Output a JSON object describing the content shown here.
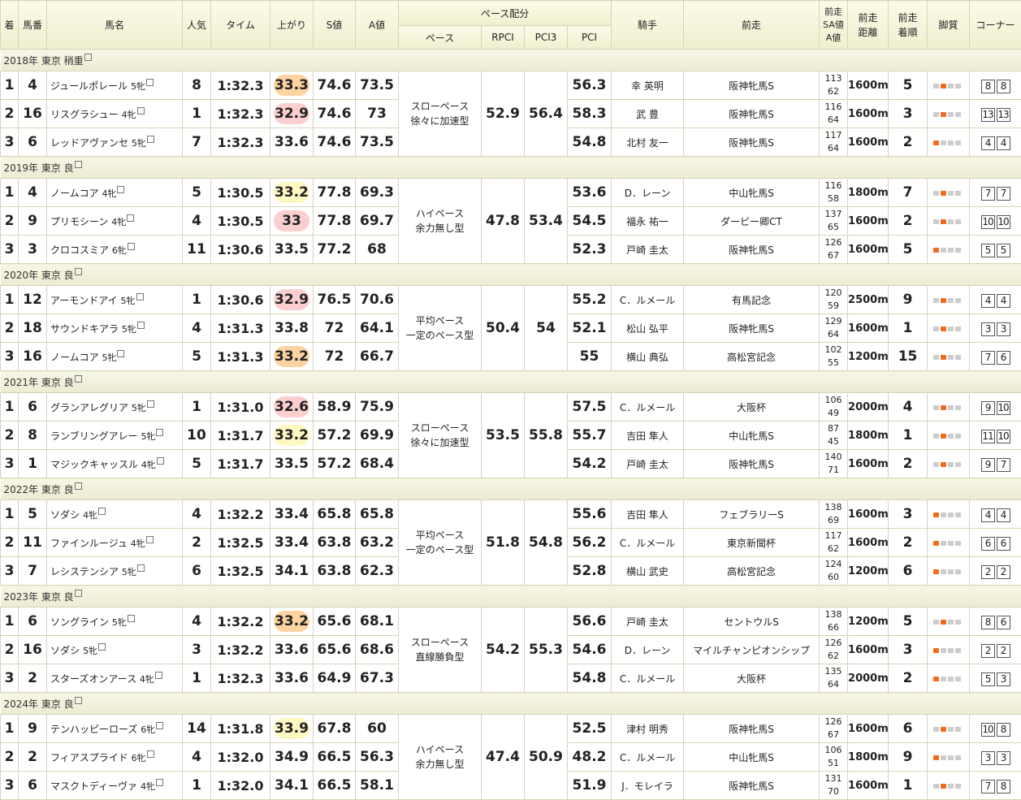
{
  "headers": {
    "chaku": "着",
    "umaban": "馬番",
    "bamei": "馬名",
    "ninki": "人気",
    "time": "タイム",
    "agari": "上がり",
    "s": "S値",
    "a": "A値",
    "pace_group": "ペース配分",
    "pace": "ペース",
    "rpci": "RPCI",
    "pci3": "PCI3",
    "pci": "PCI",
    "jockey": "騎手",
    "prev": "前走",
    "sa": [
      "前走",
      "SA値",
      "A値"
    ],
    "prevdist": [
      "前走",
      "距離"
    ],
    "prevrank": [
      "前走",
      "着順"
    ],
    "leg": "脚質",
    "corner": "コーナー"
  },
  "sections": [
    {
      "title": "2018年 東京 稍重",
      "pace": [
        "スローペース",
        "徐々に加速型"
      ],
      "rpci": "52.9",
      "pci3": "56.4",
      "rows": [
        {
          "rank": "1",
          "num": "4",
          "name": "ジュールポレール",
          "sex": "5牝",
          "ninki": "8",
          "time": "1:32.3",
          "agari": "33.3",
          "hl": "orange",
          "s": "74.6",
          "a": "73.5",
          "pci": "56.3",
          "jockey": "幸 英明",
          "prev": "阪神牝馬S",
          "sa1": "113",
          "sa2": "62",
          "dist": "1600m",
          "prank": "5",
          "leg": 2,
          "c1": "8",
          "c2": "8"
        },
        {
          "rank": "2",
          "num": "16",
          "name": "リスグラシュー",
          "sex": "4牝",
          "ninki": "1",
          "time": "1:32.3",
          "agari": "32.9",
          "hl": "pink",
          "s": "74.6",
          "a": "73",
          "pci": "58.3",
          "jockey": "武 豊",
          "prev": "阪神牝馬S",
          "sa1": "116",
          "sa2": "64",
          "dist": "1600m",
          "prank": "3",
          "leg": 2,
          "c1": "13",
          "c2": "13"
        },
        {
          "rank": "3",
          "num": "6",
          "name": "レッドアヴァンセ",
          "sex": "5牝",
          "ninki": "7",
          "time": "1:32.3",
          "agari": "33.6",
          "hl": "",
          "s": "74.6",
          "a": "73.5",
          "pci": "54.8",
          "jockey": "北村 友一",
          "prev": "阪神牝馬S",
          "sa1": "117",
          "sa2": "64",
          "dist": "1600m",
          "prank": "2",
          "leg": 1,
          "c1": "4",
          "c2": "4"
        }
      ]
    },
    {
      "title": "2019年 東京 良",
      "pace": [
        "ハイペース",
        "余力無し型"
      ],
      "rpci": "47.8",
      "pci3": "53.4",
      "rows": [
        {
          "rank": "1",
          "num": "4",
          "name": "ノームコア",
          "sex": "4牝",
          "ninki": "5",
          "time": "1:30.5",
          "agari": "33.2",
          "hl": "yellow",
          "s": "77.8",
          "a": "69.3",
          "pci": "53.6",
          "jockey": "D．レーン",
          "prev": "中山牝馬S",
          "sa1": "116",
          "sa2": "58",
          "dist": "1800m",
          "prank": "7",
          "leg": 2,
          "c1": "7",
          "c2": "7"
        },
        {
          "rank": "2",
          "num": "9",
          "name": "プリモシーン",
          "sex": "4牝",
          "ninki": "4",
          "time": "1:30.5",
          "agari": "33",
          "hl": "pink",
          "s": "77.8",
          "a": "69.7",
          "pci": "54.5",
          "jockey": "福永 祐一",
          "prev": "ダービー卿CT",
          "sa1": "137",
          "sa2": "65",
          "dist": "1600m",
          "prank": "2",
          "leg": 2,
          "c1": "10",
          "c2": "10"
        },
        {
          "rank": "3",
          "num": "3",
          "name": "クロコスミア",
          "sex": "6牝",
          "ninki": "11",
          "time": "1:30.6",
          "agari": "33.5",
          "hl": "",
          "s": "77.2",
          "a": "68",
          "pci": "52.3",
          "jockey": "戸崎 圭太",
          "prev": "阪神牝馬S",
          "sa1": "126",
          "sa2": "67",
          "dist": "1600m",
          "prank": "5",
          "leg": 1,
          "c1": "5",
          "c2": "5"
        }
      ]
    },
    {
      "title": "2020年 東京 良",
      "pace": [
        "平均ペース",
        "一定のペース型"
      ],
      "rpci": "50.4",
      "pci3": "54",
      "rows": [
        {
          "rank": "1",
          "num": "12",
          "name": "アーモンドアイ",
          "sex": "5牝",
          "ninki": "1",
          "time": "1:30.6",
          "agari": "32.9",
          "hl": "pink",
          "s": "76.5",
          "a": "70.6",
          "pci": "55.2",
          "jockey": "C．ルメール",
          "prev": "有馬記念",
          "sa1": "120",
          "sa2": "59",
          "dist": "2500m",
          "prank": "9",
          "leg": 2,
          "c1": "4",
          "c2": "4"
        },
        {
          "rank": "2",
          "num": "18",
          "name": "サウンドキアラ",
          "sex": "5牝",
          "ninki": "4",
          "time": "1:31.3",
          "agari": "33.8",
          "hl": "",
          "s": "72",
          "a": "64.1",
          "pci": "52.1",
          "jockey": "松山 弘平",
          "prev": "阪神牝馬S",
          "sa1": "129",
          "sa2": "64",
          "dist": "1600m",
          "prank": "1",
          "leg": 2,
          "c1": "3",
          "c2": "3"
        },
        {
          "rank": "3",
          "num": "16",
          "name": "ノームコア",
          "sex": "5牝",
          "ninki": "5",
          "time": "1:31.3",
          "agari": "33.2",
          "hl": "orange",
          "s": "72",
          "a": "66.7",
          "pci": "55",
          "jockey": "横山 典弘",
          "prev": "高松宮記念",
          "sa1": "102",
          "sa2": "55",
          "dist": "1200m",
          "prank": "15",
          "leg": 2,
          "c1": "7",
          "c2": "6"
        }
      ]
    },
    {
      "title": "2021年 東京 良",
      "pace": [
        "スローペース",
        "徐々に加速型"
      ],
      "rpci": "53.5",
      "pci3": "55.8",
      "rows": [
        {
          "rank": "1",
          "num": "6",
          "name": "グランアレグリア",
          "sex": "5牝",
          "ninki": "1",
          "time": "1:31.0",
          "agari": "32.6",
          "hl": "pink",
          "s": "58.9",
          "a": "75.9",
          "pci": "57.5",
          "jockey": "C．ルメール",
          "prev": "大阪杯",
          "sa1": "106",
          "sa2": "49",
          "dist": "2000m",
          "prank": "4",
          "leg": 2,
          "c1": "9",
          "c2": "10"
        },
        {
          "rank": "2",
          "num": "8",
          "name": "ランブリングアレー",
          "sex": "5牝",
          "ninki": "10",
          "time": "1:31.7",
          "agari": "33.2",
          "hl": "yellow",
          "s": "57.2",
          "a": "69.9",
          "pci": "55.7",
          "jockey": "吉田 隼人",
          "prev": "中山牝馬S",
          "sa1": "87",
          "sa2": "45",
          "dist": "1800m",
          "prank": "1",
          "leg": 2,
          "c1": "11",
          "c2": "10"
        },
        {
          "rank": "3",
          "num": "1",
          "name": "マジックキャッスル",
          "sex": "4牝",
          "ninki": "5",
          "time": "1:31.7",
          "agari": "33.5",
          "hl": "",
          "s": "57.2",
          "a": "68.4",
          "pci": "54.2",
          "jockey": "戸崎 圭太",
          "prev": "阪神牝馬S",
          "sa1": "140",
          "sa2": "71",
          "dist": "1600m",
          "prank": "2",
          "leg": 2,
          "c1": "9",
          "c2": "7"
        }
      ]
    },
    {
      "title": "2022年 東京 良",
      "pace": [
        "平均ペース",
        "一定のペース型"
      ],
      "rpci": "51.8",
      "pci3": "54.8",
      "rows": [
        {
          "rank": "1",
          "num": "5",
          "name": "ソダシ",
          "sex": "4牝",
          "ninki": "4",
          "time": "1:32.2",
          "agari": "33.4",
          "hl": "",
          "s": "65.8",
          "a": "65.8",
          "pci": "55.6",
          "jockey": "吉田 隼人",
          "prev": "フェブラリーS",
          "sa1": "138",
          "sa2": "69",
          "dist": "1600m",
          "prank": "3",
          "leg": 1,
          "c1": "4",
          "c2": "4"
        },
        {
          "rank": "2",
          "num": "11",
          "name": "ファインルージュ",
          "sex": "4牝",
          "ninki": "2",
          "time": "1:32.5",
          "agari": "33.4",
          "hl": "",
          "s": "63.8",
          "a": "63.2",
          "pci": "56.2",
          "jockey": "C．ルメール",
          "prev": "東京新聞杯",
          "sa1": "117",
          "sa2": "62",
          "dist": "1600m",
          "prank": "2",
          "leg": 1,
          "c1": "6",
          "c2": "6"
        },
        {
          "rank": "3",
          "num": "7",
          "name": "レシステンシア",
          "sex": "5牝",
          "ninki": "6",
          "time": "1:32.5",
          "agari": "34.1",
          "hl": "",
          "s": "63.8",
          "a": "62.3",
          "pci": "52.8",
          "jockey": "横山 武史",
          "prev": "高松宮記念",
          "sa1": "124",
          "sa2": "60",
          "dist": "1200m",
          "prank": "6",
          "leg": 1,
          "c1": "2",
          "c2": "2"
        }
      ]
    },
    {
      "title": "2023年 東京 良",
      "pace": [
        "スローペース",
        "直線勝負型"
      ],
      "rpci": "54.2",
      "pci3": "55.3",
      "rows": [
        {
          "rank": "1",
          "num": "6",
          "name": "ソングライン",
          "sex": "5牝",
          "ninki": "4",
          "time": "1:32.2",
          "agari": "33.2",
          "hl": "orange",
          "s": "65.6",
          "a": "68.1",
          "pci": "56.6",
          "jockey": "戸崎 圭太",
          "prev": "セントウルS",
          "sa1": "138",
          "sa2": "66",
          "dist": "1200m",
          "prank": "5",
          "leg": 2,
          "c1": "8",
          "c2": "6"
        },
        {
          "rank": "2",
          "num": "16",
          "name": "ソダシ",
          "sex": "5牝",
          "ninki": "3",
          "time": "1:32.2",
          "agari": "33.6",
          "hl": "",
          "s": "65.6",
          "a": "68.6",
          "pci": "54.6",
          "jockey": "D．レーン",
          "prev": "マイルチャンピオンシップ",
          "sa1": "126",
          "sa2": "62",
          "dist": "1600m",
          "prank": "3",
          "leg": 1,
          "c1": "2",
          "c2": "2"
        },
        {
          "rank": "3",
          "num": "2",
          "name": "スターズオンアース",
          "sex": "4牝",
          "ninki": "1",
          "time": "1:32.3",
          "agari": "33.6",
          "hl": "",
          "s": "64.9",
          "a": "67.3",
          "pci": "54.8",
          "jockey": "C．ルメール",
          "prev": "大阪杯",
          "sa1": "135",
          "sa2": "64",
          "dist": "2000m",
          "prank": "2",
          "leg": 1,
          "c1": "5",
          "c2": "3"
        }
      ]
    },
    {
      "title": "2024年 東京 良",
      "pace": [
        "ハイペース",
        "余力無し型"
      ],
      "rpci": "47.4",
      "pci3": "50.9",
      "rows": [
        {
          "rank": "1",
          "num": "9",
          "name": "テンハッピーローズ",
          "sex": "6牝",
          "ninki": "14",
          "time": "1:31.8",
          "agari": "33.9",
          "hl": "yellow",
          "s": "67.8",
          "a": "60",
          "pci": "52.5",
          "jockey": "津村 明秀",
          "prev": "阪神牝馬S",
          "sa1": "126",
          "sa2": "67",
          "dist": "1600m",
          "prank": "6",
          "leg": 2,
          "c1": "10",
          "c2": "8"
        },
        {
          "rank": "2",
          "num": "2",
          "name": "フィアスプライド",
          "sex": "6牝",
          "ninki": "4",
          "time": "1:32.0",
          "agari": "34.9",
          "hl": "",
          "s": "66.5",
          "a": "56.3",
          "pci": "48.2",
          "jockey": "C．ルメール",
          "prev": "中山牝馬S",
          "sa1": "106",
          "sa2": "51",
          "dist": "1800m",
          "prank": "9",
          "leg": 1,
          "c1": "3",
          "c2": "3"
        },
        {
          "rank": "3",
          "num": "6",
          "name": "マスクトディーヴァ",
          "sex": "4牝",
          "ninki": "1",
          "time": "1:32.0",
          "agari": "34.1",
          "hl": "",
          "s": "66.5",
          "a": "58.1",
          "pci": "51.9",
          "jockey": "J．モレイラ",
          "prev": "阪神牝馬S",
          "sa1": "131",
          "sa2": "70",
          "dist": "1600m",
          "prank": "1",
          "leg": 2,
          "c1": "7",
          "c2": "8"
        }
      ]
    }
  ]
}
